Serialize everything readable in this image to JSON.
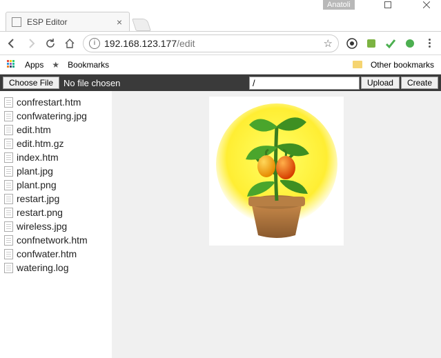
{
  "window": {
    "profile": "Anatoli"
  },
  "tab": {
    "title": "ESP Editor"
  },
  "addressbar": {
    "host": "192.168.123.177",
    "path": "/edit"
  },
  "bookmarks": {
    "apps": "Apps",
    "bookmarks": "Bookmarks",
    "other": "Other bookmarks"
  },
  "actionbar": {
    "choose": "Choose File",
    "nofile": "No file chosen",
    "path_value": "/",
    "upload": "Upload",
    "create": "Create"
  },
  "files": [
    "confrestart.htm",
    "confwatering.jpg",
    "edit.htm",
    "edit.htm.gz",
    "index.htm",
    "plant.jpg",
    "plant.png",
    "restart.jpg",
    "restart.png",
    "wireless.jpg",
    "confnetwork.htm",
    "confwater.htm",
    "watering.log"
  ]
}
